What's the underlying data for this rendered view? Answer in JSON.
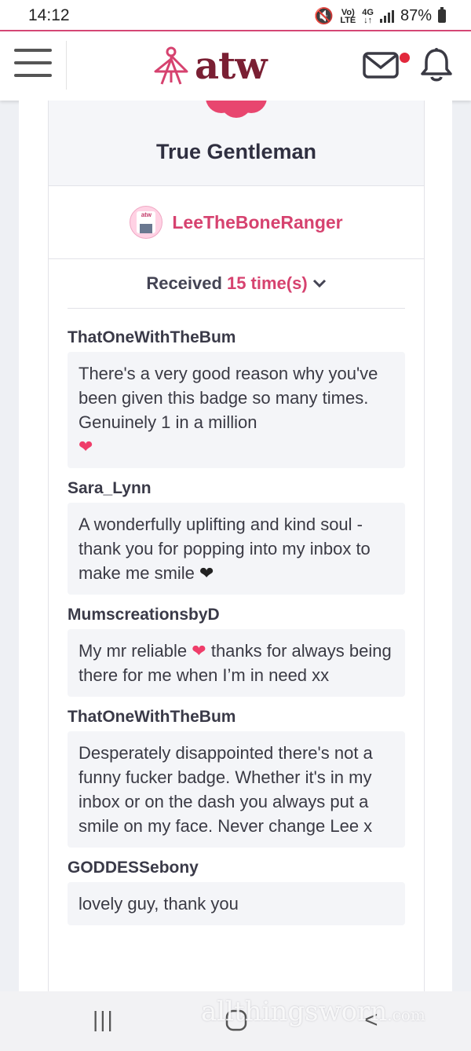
{
  "status_bar": {
    "time": "14:12",
    "network_top": "Vo)",
    "network_bottom": "LTE",
    "gen_top": "4G",
    "gen_bottom": "↓↑",
    "battery": "87%"
  },
  "header": {
    "logo_text": "atw",
    "icons": {
      "menu": "hamburger-menu-icon",
      "mail": "envelope-icon",
      "bell": "bell-icon"
    },
    "notification_color": "#e2283c"
  },
  "badge": {
    "title": "True Gentleman",
    "color": "#e8466f"
  },
  "user": {
    "username": "LeeTheBoneRanger",
    "avatar_text": "atw"
  },
  "received": {
    "prefix": "Received",
    "count_label": "15 time(s)"
  },
  "comments": [
    {
      "author": "ThatOneWithTheBum",
      "text": "There's a very good reason why you've been given this badge so many times. Genuinely 1 in a million",
      "emoji": "❤",
      "emoji_color": "pink"
    },
    {
      "author": "Sara_Lynn",
      "text": "A wonderfully uplifting and kind soul - thank you for popping into my inbox to make me smile",
      "emoji": "❤",
      "emoji_color": "black"
    },
    {
      "author": "MumscreationsbyD",
      "text_before": "My mr reliable",
      "emoji": "❤",
      "text_after": "thanks for always being there for me when I’m in need xx"
    },
    {
      "author": "ThatOneWithTheBum",
      "text": "Desperately disappointed there's not a funny fucker badge. Whether it's in my inbox or on the dash you always put a smile on my face. Never change Lee x"
    },
    {
      "author": "GODDESSebony",
      "text": "lovely guy, thank you"
    }
  ],
  "watermark": {
    "text": "allthingsworn",
    "domain": ".com"
  },
  "nav_bar": {
    "recents": "|||",
    "back": "<"
  }
}
